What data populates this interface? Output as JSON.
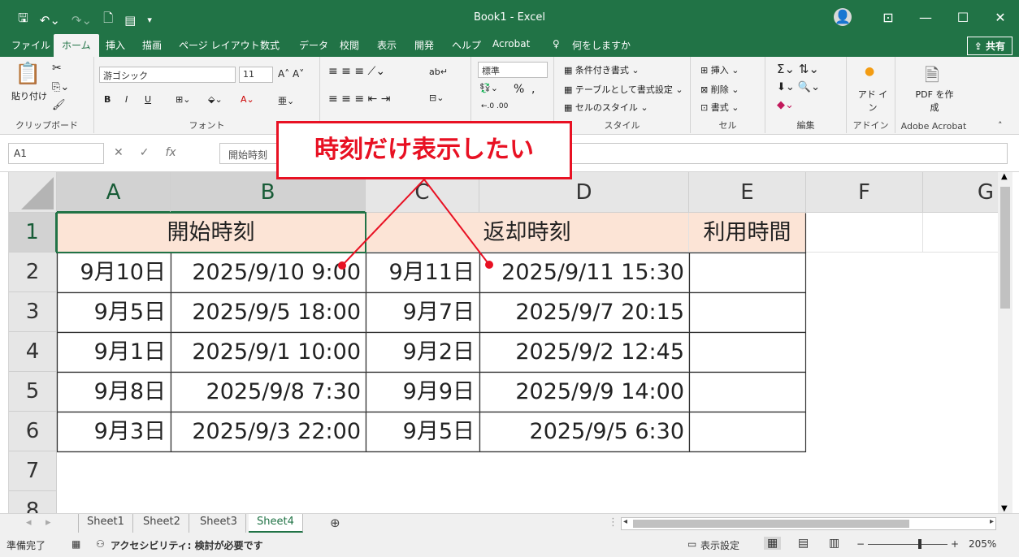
{
  "window": {
    "title": "Book1  -  Excel",
    "qat": [
      "save-icon",
      "undo-icon",
      "redo-icon",
      "print-preview-icon",
      "form-icon",
      "customize-icon"
    ]
  },
  "tabs": [
    "ファイル",
    "ホーム",
    "挿入",
    "描画",
    "ページ レイアウト",
    "数式",
    "データ",
    "校閲",
    "表示",
    "開発",
    "ヘルプ",
    "Acrobat",
    "何をしますか"
  ],
  "share_label": "共有",
  "ribbon": {
    "clipboard": {
      "paste": "貼り付け",
      "label": "クリップボード"
    },
    "font": {
      "name": "游ゴシック",
      "size": "11",
      "label": "フォント",
      "bold": "B",
      "italic": "I",
      "underline": "U"
    },
    "alignment": {
      "label": ""
    },
    "number": {
      "format": "標準",
      "percent": "%",
      "comma": ","
    },
    "styles": {
      "conditional": "条件付き書式",
      "table": "テーブルとして書式設定",
      "cell": "セルのスタイル",
      "label": "スタイル"
    },
    "cells": {
      "insert": "挿入",
      "delete": "削除",
      "format": "書式",
      "label": "セル"
    },
    "editing": {
      "label": "編集"
    },
    "addins": {
      "name": "アド イン",
      "label": "アドイン"
    },
    "acrobat": {
      "name": "PDF を作成",
      "label": "Adobe Acrobat"
    }
  },
  "formula_bar": {
    "name_box": "A1",
    "value": "開始時刻"
  },
  "columns": [
    "A",
    "B",
    "C",
    "D",
    "E",
    "F",
    "G"
  ],
  "rows": [
    "1",
    "2",
    "3",
    "4",
    "5",
    "6",
    "7",
    "8"
  ],
  "table": {
    "headers": {
      "start": "開始時刻",
      "return": "返却時刻",
      "usage": "利用時間"
    },
    "data": [
      {
        "a": "9月10日",
        "b": "2025/9/10 9:00",
        "c": "9月11日",
        "d": "2025/9/11 15:30"
      },
      {
        "a": "9月5日",
        "b": "2025/9/5 18:00",
        "c": "9月7日",
        "d": "2025/9/7 20:15"
      },
      {
        "a": "9月1日",
        "b": "2025/9/1 10:00",
        "c": "9月2日",
        "d": "2025/9/2 12:45"
      },
      {
        "a": "9月8日",
        "b": "2025/9/8 7:30",
        "c": "9月9日",
        "d": "2025/9/9 14:00"
      },
      {
        "a": "9月3日",
        "b": "2025/9/3 22:00",
        "c": "9月5日",
        "d": "2025/9/5 6:30"
      }
    ]
  },
  "callout": "時刻だけ表示したい",
  "sheets": [
    "Sheet1",
    "Sheet2",
    "Sheet3",
    "Sheet4"
  ],
  "active_sheet": "Sheet4",
  "status": {
    "ready": "準備完了",
    "accessibility": "アクセシビリティ: 検討が必要です",
    "display_settings": "表示設定",
    "zoom": "205%"
  },
  "colors": {
    "excel_green": "#217346",
    "header_fill": "#fce4d6",
    "callout_red": "#e81123"
  }
}
